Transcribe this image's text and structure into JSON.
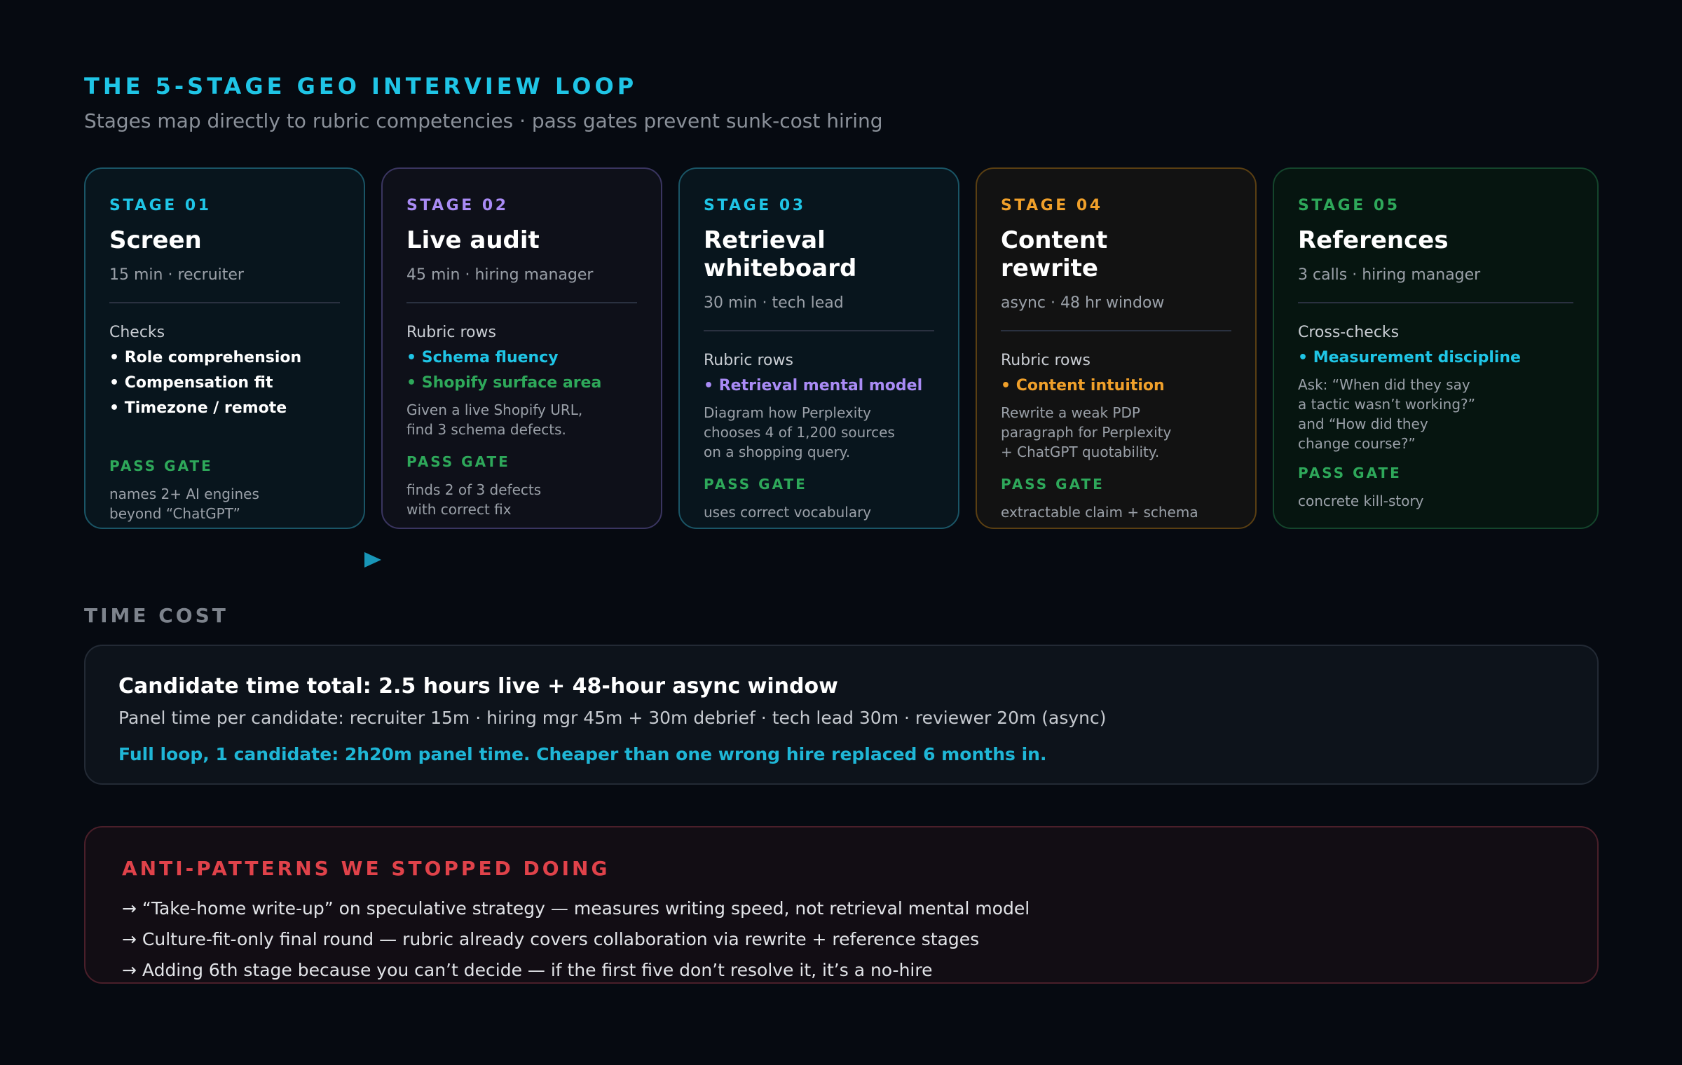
{
  "header": {
    "title": "THE 5-STAGE GEO INTERVIEW LOOP",
    "subtitle": "Stages map directly to rubric competencies · pass gates prevent sunk-cost hiring"
  },
  "colors": {
    "cyan": "#1fc5e6",
    "purple": "#a98bf5",
    "orange": "#f0a02a",
    "green": "#2ea85a",
    "red": "#e0424a"
  },
  "stages": [
    {
      "label": "STAGE 01",
      "name": "Screen",
      "meta": "15 min · recruiter",
      "rubric_title": "Checks",
      "items": [
        "Role comprehension",
        "Compensation fit",
        "Timezone / remote"
      ],
      "description": "",
      "gate_label": "PASS GATE",
      "gate_text": "names 2+ AI engines\nbeyond “ChatGPT”"
    },
    {
      "label": "STAGE 02",
      "name": "Live audit",
      "meta": "45 min · hiring manager",
      "rubric_title": "Rubric rows",
      "items": [
        "Schema fluency",
        "Shopify surface area"
      ],
      "description": "Given a live Shopify URL,\nfind 3 schema defects.",
      "gate_label": "PASS GATE",
      "gate_text": "finds 2 of 3 defects\nwith correct fix"
    },
    {
      "label": "STAGE 03",
      "name": "Retrieval\nwhiteboard",
      "meta": "30 min · tech lead",
      "rubric_title": "Rubric rows",
      "items": [
        "Retrieval mental model"
      ],
      "description": "Diagram how Perplexity\nchooses 4 of 1,200 sources\non a shopping query.",
      "gate_label": "PASS GATE",
      "gate_text": "uses correct vocabulary"
    },
    {
      "label": "STAGE 04",
      "name": "Content\nrewrite",
      "meta": "async · 48 hr window",
      "rubric_title": "Rubric rows",
      "items": [
        "Content intuition"
      ],
      "description": "Rewrite a weak PDP\nparagraph for Perplexity\n+ ChatGPT quotability.",
      "gate_label": "PASS GATE",
      "gate_text": "extractable claim + schema"
    },
    {
      "label": "STAGE 05",
      "name": "References",
      "meta": "3 calls · hiring manager",
      "rubric_title": "Cross-checks",
      "items": [
        "Measurement discipline"
      ],
      "description": "Ask: “When did they say\na tactic wasn’t working?”\nand “How did they\nchange course?”",
      "gate_label": "PASS GATE",
      "gate_text": "concrete kill-story"
    }
  ],
  "time_cost": {
    "section_label": "TIME COST",
    "headline": "Candidate time total: 2.5 hours live + 48-hour async window",
    "panel_time": "Panel time per candidate: recruiter 15m · hiring mgr 45m + 30m debrief · tech lead 30m · reviewer 20m (async)",
    "summary": "Full loop, 1 candidate: 2h20m panel time. Cheaper than one wrong hire replaced 6 months in."
  },
  "anti_patterns": {
    "title": "ANTI-PATTERNS WE STOPPED DOING",
    "items": [
      "“Take-home write-up” on speculative strategy — measures writing speed, not retrieval mental model",
      "Culture-fit-only final round — rubric already covers collaboration via rewrite + reference stages",
      "Adding 6th stage because you can’t decide — if the first five don’t resolve it, it’s a no-hire"
    ]
  }
}
